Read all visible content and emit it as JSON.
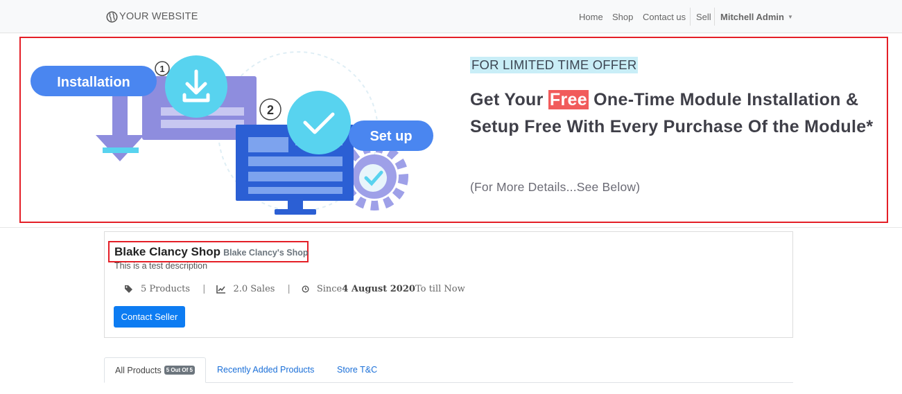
{
  "navbar": {
    "brand": "YOUR WEBSITE",
    "items": [
      "Home",
      "Shop",
      "Contact us",
      "Sell"
    ],
    "user": "Mitchell Admin"
  },
  "banner": {
    "tag": "FOR LIMITED TIME OFFER",
    "headline_pre": "Get Your ",
    "headline_free": "Free",
    "headline_post": " One-Time Module Installation & Setup Free With Every Purchase Of the Module*",
    "details": "(For More Details...See Below)",
    "art": {
      "installation_label": "Installation",
      "setup_label": "Set up",
      "step1": "1",
      "step2": "2"
    }
  },
  "seller": {
    "name": "Blake Clancy Shop",
    "subtitle": "Blake Clancy's Shop",
    "description": "This is a test description",
    "products": "5 Products",
    "sales": "2.0 Sales",
    "since_prefix": "Since ",
    "since_date": "4 August 2020",
    "since_suffix": " To till Now",
    "contact_label": "Contact Seller"
  },
  "tabs": {
    "all": "All Products",
    "all_badge": "5 Out Of 5",
    "recent": "Recently Added Products",
    "store": "Store T&C"
  },
  "colors": {
    "highlight_border": "#e41e26",
    "primary": "#0d7cf2",
    "link": "#1a6fd8",
    "free_badge": "#f15b5b",
    "offer_tag_bg": "#c9eef7"
  }
}
